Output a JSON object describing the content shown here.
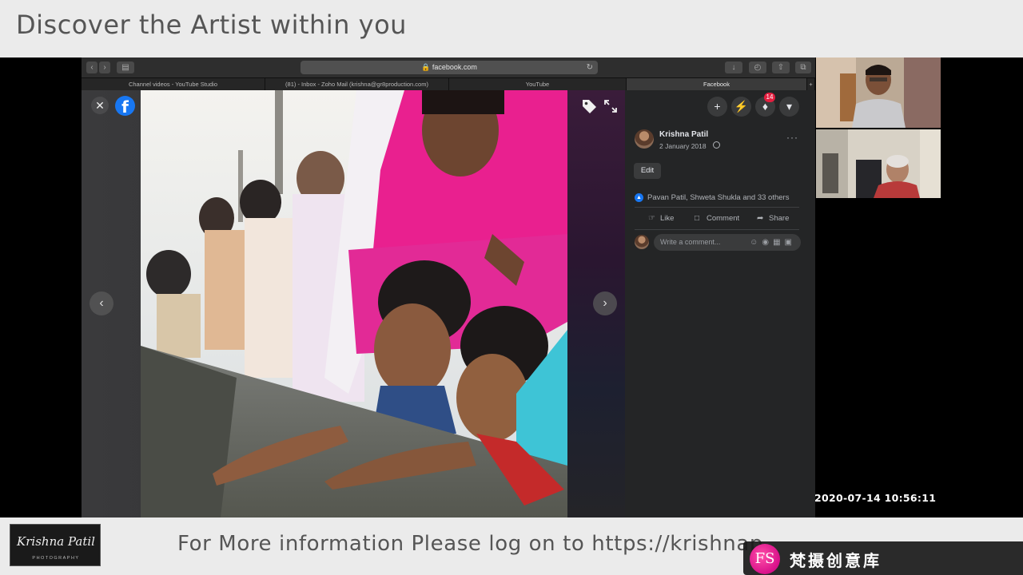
{
  "banner": {
    "title": "Discover the Artist within you",
    "info_text": "For More information Please log on to https://krishnap",
    "logo_script": "Krishna Patil",
    "logo_sub": "PHOTOGRAPHY",
    "watermark_text": "梵摄创意库",
    "watermark_mark": "FS"
  },
  "browser": {
    "url": "facebook.com",
    "tabs": [
      {
        "label": "Channel videos - YouTube Studio",
        "active": false
      },
      {
        "label": "(81) - Inbox - Zoho Mail (krishna@gr8production.com)",
        "active": false
      },
      {
        "label": "YouTube",
        "active": false
      },
      {
        "label": "Facebook",
        "active": true
      }
    ]
  },
  "facebook": {
    "notification_count": "14",
    "author": "Krishna Patil",
    "date": "2 January 2018",
    "edit_label": "Edit",
    "reactions": "Pavan Patil, Shweta Shukla and 33 others",
    "actions": {
      "like": "Like",
      "comment": "Comment",
      "share": "Share"
    },
    "comment_placeholder": "Write a comment..."
  },
  "call": {
    "timestamp": "2020-07-14  10:56:11"
  },
  "colors": {
    "fb_blue": "#1877f2",
    "notification_red": "#e41e3f",
    "banner_bg": "#ebebeb",
    "watermark_pink": "#d8108a"
  },
  "icons": [
    "close-icon",
    "facebook-logo-icon",
    "tag-icon",
    "expand-icon",
    "chevron-left-icon",
    "chevron-right-icon",
    "plus-icon",
    "messenger-icon",
    "bell-icon",
    "caret-down-icon",
    "globe-icon",
    "more-icon",
    "like-icon",
    "comment-icon",
    "share-icon"
  ]
}
